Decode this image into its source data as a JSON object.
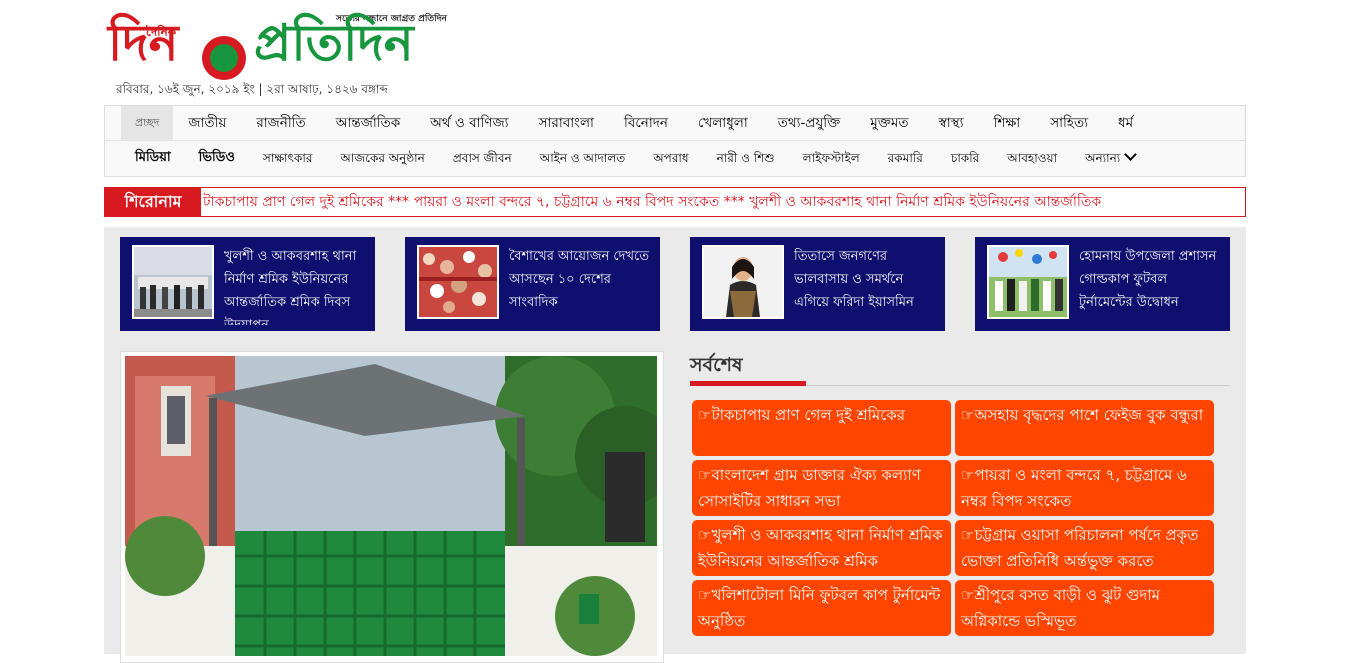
{
  "header": {
    "logo_small": "দৈনিক",
    "logo_word1": "দিন",
    "logo_word2": "প্রতিদিন",
    "tagline": "সত্যের সন্ধানে জাগ্রত প্রতিদিন",
    "date": "রবিবার, ১৬ই জুন, ২০১৯ ইং | ২রা আষাঢ়, ১৪২৬ বঙ্গাব্দ"
  },
  "nav": {
    "row1": [
      "প্রচ্ছদ",
      "জাতীয়",
      "রাজনীতি",
      "আন্তর্জাতিক",
      "অর্থ ও বাণিজ্য",
      "সারাবাংলা",
      "বিনোদন",
      "খেলাধুলা",
      "তথ্য-প্রযুক্তি",
      "মুক্তমত",
      "স্বাস্থ্য",
      "শিক্ষা",
      "সাহিত্য",
      "ধর্ম"
    ],
    "row2": [
      "মিডিয়া",
      "ভিডিও",
      "সাক্ষাৎকার",
      "আজকের অনুষ্ঠান",
      "প্রবাস জীবন",
      "আইন ও আদালত",
      "অপরাধ",
      "নারী ও শিশু",
      "লাইফস্টাইল",
      "রকমারি",
      "চাকরি",
      "আবহাওয়া",
      "অন্যান্য"
    ]
  },
  "ticker": {
    "label": "শিরোনাম",
    "text": "টাকচাপায় প্রাণ গেল দুই শ্রমিকের *** পায়রা ও মংলা বন্দরে ৭, চট্টগ্রামে ৬ নম্বর বিপদ সংকেত *** খুলশী ও আকবরশাহ থানা নির্মাণ শ্রমিক ইউনিয়নের আন্তর্জাতিক"
  },
  "featured": [
    {
      "title": "খুলশী ও আকবরশাহ থানা নির্মাণ শ্রমিক ইউনিয়নের আন্তর্জাতিক শ্রমিক দিবস উদযাপন"
    },
    {
      "title": "বৈশাখের আয়োজন দেখতে আসছেন ১০ দেশের সাংবাদিক"
    },
    {
      "title": "তিতাসে জনগণের ভালবাসায় ও সমর্থনে এগিয়ে ফরিদা ইয়াসমিন"
    },
    {
      "title": "হোমনায় উপজেলা প্রশাসন গোল্ডকাপ ফুটবল টুর্নামেন্টের উদ্বোধন"
    }
  ],
  "latest": {
    "title": "সর্বশেষ",
    "items": [
      "☞টাকচাপায় প্রাণ গেল দুই শ্রমিকের",
      "☞অসহায় বৃদ্ধদের পাশে ফেইজ বুক বন্ধুরা",
      "☞বাংলাদেশ গ্রাম ডাক্তার ঐক্য কল্যাণ সোসাইটির সাধারন সভা",
      "☞পায়রা ও মংলা বন্দরে ৭, চট্টগ্রামে ৬ নম্বর বিপদ সংকেত",
      "☞খুলশী ও আকবরশাহ থানা নির্মাণ শ্রমিক ইউনিয়নের আন্তর্জাতিক শ্রমিক",
      "☞চট্টগ্রাম ওয়াসা পরিচালনা পর্ষদে প্রকৃত ভোক্তা প্রতিনিধি অর্ন্তভুক্ত করতে",
      "☞খলিশাটোলা মিনি ফুটবল কাপ টুর্নামেন্ট অনুষ্ঠিত",
      "☞শ্রীপুরে বসত বাড়ী ও ঝুট গুদাম অগ্নিকান্ডে ভস্মিভূত"
    ]
  },
  "colors": {
    "brand_red": "#d71920",
    "brand_green": "#17963e",
    "featured_bg": "#0e0f6e",
    "latest_item_bg": "#ff4500"
  }
}
